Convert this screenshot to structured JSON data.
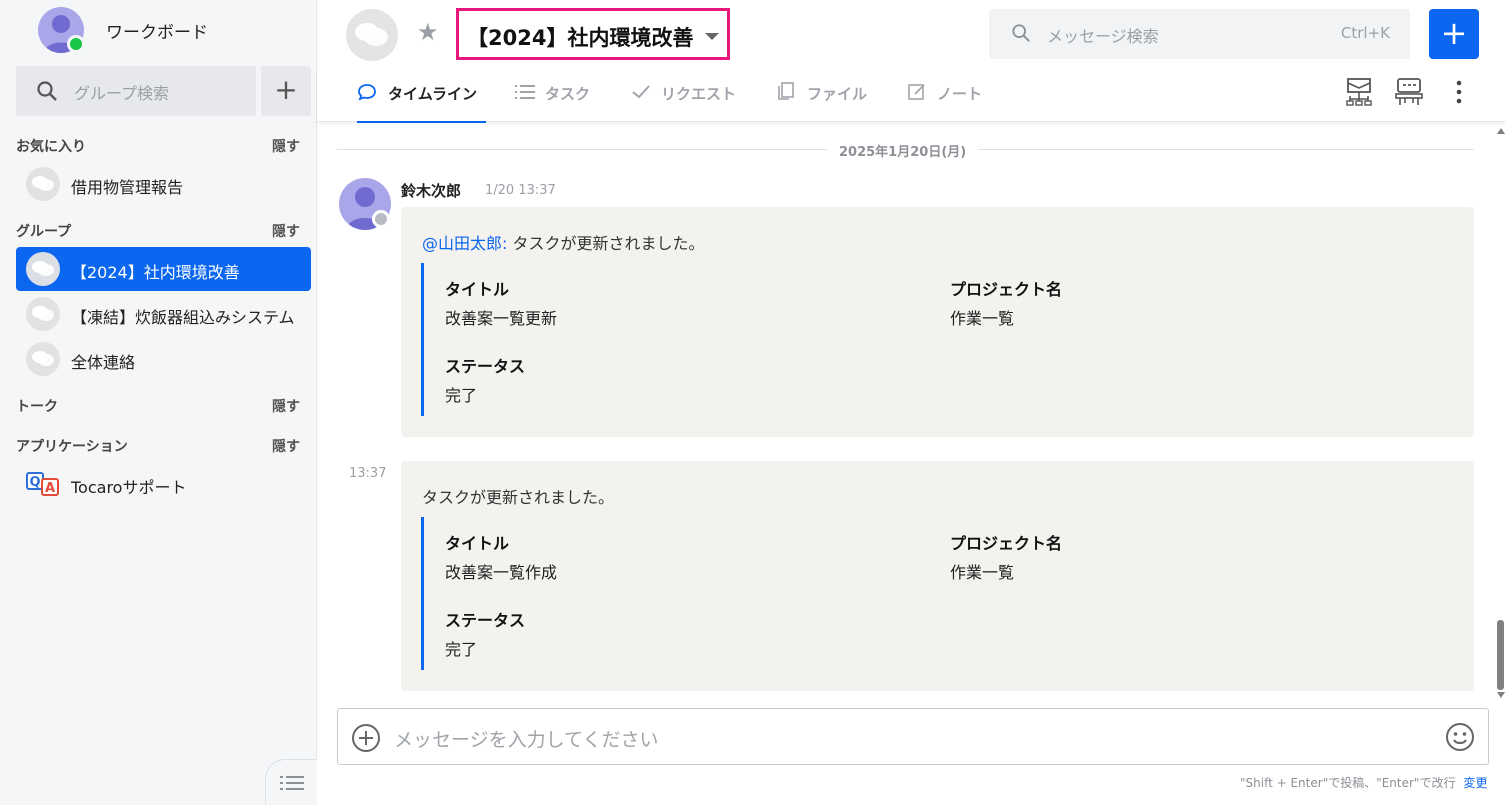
{
  "workspace": {
    "name": "ワークボード"
  },
  "sidebar": {
    "search_placeholder": "グループ検索",
    "add_label": "+",
    "sections": {
      "favorites": {
        "label": "お気に入り",
        "hide": "隠す",
        "items": [
          {
            "label": "借用物管理報告"
          }
        ]
      },
      "groups": {
        "label": "グループ",
        "hide": "隠す",
        "items": [
          {
            "label": "【2024】社内環境改善",
            "active": true
          },
          {
            "label": "【凍結】炊飯器組込みシステム"
          },
          {
            "label": "全体連絡"
          }
        ]
      },
      "talk": {
        "label": "トーク",
        "hide": "隠す"
      },
      "apps": {
        "label": "アプリケーション",
        "hide": "隠す",
        "items": [
          {
            "label": "Tocaroサポート",
            "icon": "qa-support-icon"
          }
        ]
      }
    }
  },
  "header": {
    "title": "【2024】社内環境改善",
    "search_placeholder": "メッセージ検索",
    "search_shortcut": "Ctrl+K",
    "new_label": "+",
    "tabs": [
      {
        "label": "タイムライン",
        "icon": "chat-bubble-icon",
        "active": true
      },
      {
        "label": "タスク",
        "icon": "list-icon"
      },
      {
        "label": "リクエスト",
        "icon": "check-icon"
      },
      {
        "label": "ファイル",
        "icon": "file-icon"
      },
      {
        "label": "ノート",
        "icon": "note-icon"
      }
    ]
  },
  "timeline": {
    "date": "2025年1月20日(月)",
    "author": "鈴木次郎",
    "time": "1/20 13:37",
    "messages": [
      {
        "mention": "@山田太郎:",
        "text": " タスクが更新されました。",
        "fields": [
          {
            "label": "タイトル",
            "value": "改善案一覧更新"
          },
          {
            "label": "プロジェクト名",
            "value": "作業一覧"
          },
          {
            "label": "ステータス",
            "value": "完了"
          }
        ]
      },
      {
        "side_time": "13:37",
        "text": "タスクが更新されました。",
        "fields": [
          {
            "label": "タイトル",
            "value": "改善案一覧作成"
          },
          {
            "label": "プロジェクト名",
            "value": "作業一覧"
          },
          {
            "label": "ステータス",
            "value": "完了"
          }
        ]
      }
    ]
  },
  "composer": {
    "placeholder": "メッセージを入力してください",
    "hint": "\"Shift + Enter\"で投稿、\"Enter\"で改行",
    "hint_change": "変更"
  },
  "colors": {
    "accent": "#0b67ef",
    "highlight": "#e8177c",
    "online": "#19c64a"
  }
}
